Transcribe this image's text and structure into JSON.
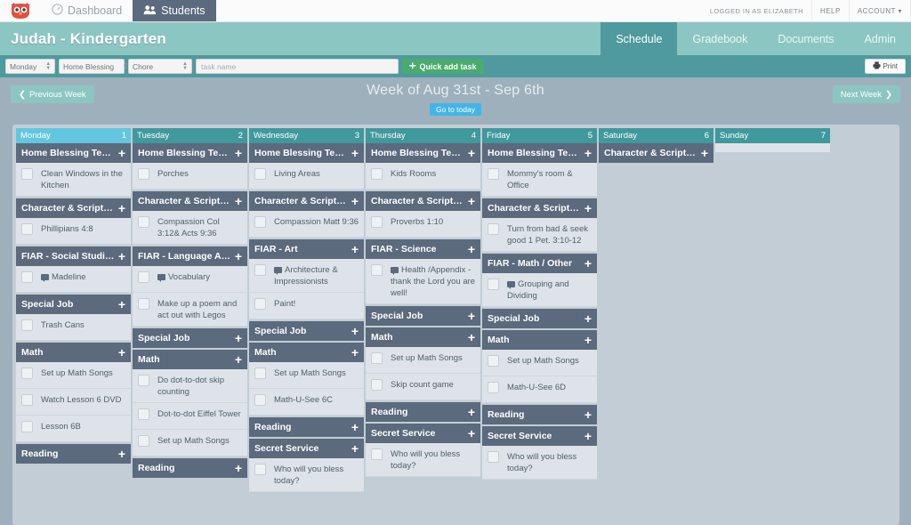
{
  "topnav": {
    "logo_icon": "owl-logo-icon",
    "items": [
      {
        "label": "Dashboard",
        "icon": "gauge-icon",
        "active": false
      },
      {
        "label": "Students",
        "icon": "people-icon",
        "active": true
      }
    ],
    "logged_in_as": "LOGGED IN AS ELIZABETH",
    "help": "HELP",
    "account": "ACCOUNT ▾"
  },
  "header": {
    "title": "Judah - Kindergarten",
    "tabs": [
      {
        "label": "Schedule",
        "active": true
      },
      {
        "label": "Gradebook",
        "active": false
      },
      {
        "label": "Documents",
        "active": false
      },
      {
        "label": "Admin",
        "active": false
      }
    ]
  },
  "toolbar": {
    "day_select": "Monday",
    "category_select": "Home Blessing",
    "type_select": "Chore",
    "task_name_placeholder": "task name",
    "task_name_value": "",
    "quick_add_label": "Quick add task",
    "quick_add_icon": "plus-icon",
    "print_label": "Print",
    "print_icon": "printer-icon"
  },
  "weeknav": {
    "prev_label": "Previous Week",
    "prev_icon": "chevron-left-icon",
    "next_label": "Next Week",
    "next_icon": "chevron-right-icon",
    "title": "Week of Aug 31st - Sep 6th",
    "today_label": "Go to today"
  },
  "calendar": {
    "plus_icon": "plus-icon",
    "days": [
      {
        "name": "Monday",
        "num": "1",
        "today": true,
        "groups": [
          {
            "category": "Home Blessing Team",
            "tasks": [
              {
                "text": "Clean Windows in the Kitchen",
                "note": false
              }
            ]
          },
          {
            "category": "Character & Scripture...",
            "tasks": [
              {
                "text": "Phillipians 4:8",
                "note": false
              }
            ]
          },
          {
            "category": "FIAR - Social Studies",
            "tasks": [
              {
                "text": "Madeline",
                "note": true
              }
            ]
          },
          {
            "category": "Special Job",
            "tasks": [
              {
                "text": "Trash Cans",
                "note": false
              }
            ]
          },
          {
            "category": "Math",
            "tasks": [
              {
                "text": "Set up Math Songs",
                "note": false
              },
              {
                "text": "Watch Lesson 6 DVD",
                "note": false
              },
              {
                "text": "Lesson 6B",
                "note": false
              }
            ]
          },
          {
            "category": "Reading",
            "tasks": []
          }
        ]
      },
      {
        "name": "Tuesday",
        "num": "2",
        "today": false,
        "groups": [
          {
            "category": "Home Blessing Team",
            "tasks": [
              {
                "text": "Porches",
                "note": false
              }
            ]
          },
          {
            "category": "Character & Scripture...",
            "tasks": [
              {
                "text": "Compassion Col 3:12& Acts 9:36",
                "note": false
              }
            ]
          },
          {
            "category": "FIAR - Language Arts",
            "tasks": [
              {
                "text": "Vocabulary",
                "note": true
              },
              {
                "text": "Make up a poem and act out with Legos",
                "note": false
              }
            ]
          },
          {
            "category": "Special Job",
            "tasks": []
          },
          {
            "category": "Math",
            "tasks": [
              {
                "text": "Do dot-to-dot skip counting",
                "note": false
              },
              {
                "text": "Dot-to-dot Eiffel Tower",
                "note": false
              },
              {
                "text": "Set up Math Songs",
                "note": false
              }
            ]
          },
          {
            "category": "Reading",
            "tasks": []
          }
        ]
      },
      {
        "name": "Wednesday",
        "num": "3",
        "today": false,
        "groups": [
          {
            "category": "Home Blessing Team",
            "tasks": [
              {
                "text": "Living Areas",
                "note": false
              }
            ]
          },
          {
            "category": "Character & Scripture...",
            "tasks": [
              {
                "text": "Compassion Matt 9:36",
                "note": false
              }
            ]
          },
          {
            "category": "FIAR - Art",
            "tasks": [
              {
                "text": "Architecture & Impressionists",
                "note": true
              },
              {
                "text": "Paint!",
                "note": false
              }
            ]
          },
          {
            "category": "Special Job",
            "tasks": []
          },
          {
            "category": "Math",
            "tasks": [
              {
                "text": "Set up Math Songs",
                "note": false
              },
              {
                "text": "Math-U-See 6C",
                "note": false
              }
            ]
          },
          {
            "category": "Reading",
            "tasks": []
          },
          {
            "category": "Secret Service",
            "tasks": [
              {
                "text": "Who will you bless today?",
                "note": false
              }
            ]
          }
        ]
      },
      {
        "name": "Thursday",
        "num": "4",
        "today": false,
        "groups": [
          {
            "category": "Home Blessing Team",
            "tasks": [
              {
                "text": "Kids Rooms",
                "note": false
              }
            ]
          },
          {
            "category": "Character & Scripture...",
            "tasks": [
              {
                "text": "Proverbs 1:10",
                "note": false
              }
            ]
          },
          {
            "category": "FIAR - Science",
            "tasks": [
              {
                "text": "Health /Appendix - thank the Lord you are well!",
                "note": true
              }
            ]
          },
          {
            "category": "Special Job",
            "tasks": []
          },
          {
            "category": "Math",
            "tasks": [
              {
                "text": "Set up Math Songs",
                "note": false
              },
              {
                "text": "Skip count game",
                "note": false
              }
            ]
          },
          {
            "category": "Reading",
            "tasks": []
          },
          {
            "category": "Secret Service",
            "tasks": [
              {
                "text": "Who will you bless today?",
                "note": false
              }
            ]
          }
        ]
      },
      {
        "name": "Friday",
        "num": "5",
        "today": false,
        "groups": [
          {
            "category": "Home Blessing Team",
            "tasks": [
              {
                "text": "Mommy's room & Office",
                "note": false
              }
            ]
          },
          {
            "category": "Character & Scripture...",
            "tasks": [
              {
                "text": "Turn from bad & seek good 1 Pet. 3:10-12",
                "note": false
              }
            ]
          },
          {
            "category": "FIAR - Math / Other",
            "tasks": [
              {
                "text": "Grouping and Dividing",
                "note": true
              }
            ]
          },
          {
            "category": "Special Job",
            "tasks": []
          },
          {
            "category": "Math",
            "tasks": [
              {
                "text": "Set up Math Songs",
                "note": false
              },
              {
                "text": "Math-U-See 6D",
                "note": false
              }
            ]
          },
          {
            "category": "Reading",
            "tasks": []
          },
          {
            "category": "Secret Service",
            "tasks": [
              {
                "text": "Who will you bless today?",
                "note": false
              }
            ]
          }
        ]
      },
      {
        "name": "Saturday",
        "num": "6",
        "today": false,
        "groups": [
          {
            "category": "Character & Scripture...",
            "tasks": []
          }
        ]
      },
      {
        "name": "Sunday",
        "num": "7",
        "today": false,
        "groups": []
      }
    ]
  },
  "colors": {
    "teal": "#4e9a9f",
    "teal_light": "#8cc6c2",
    "today_blue": "#62c6de",
    "category_slate": "#5b6a7d",
    "green": "#49ab6e",
    "page_bg": "#9fb0bd"
  }
}
